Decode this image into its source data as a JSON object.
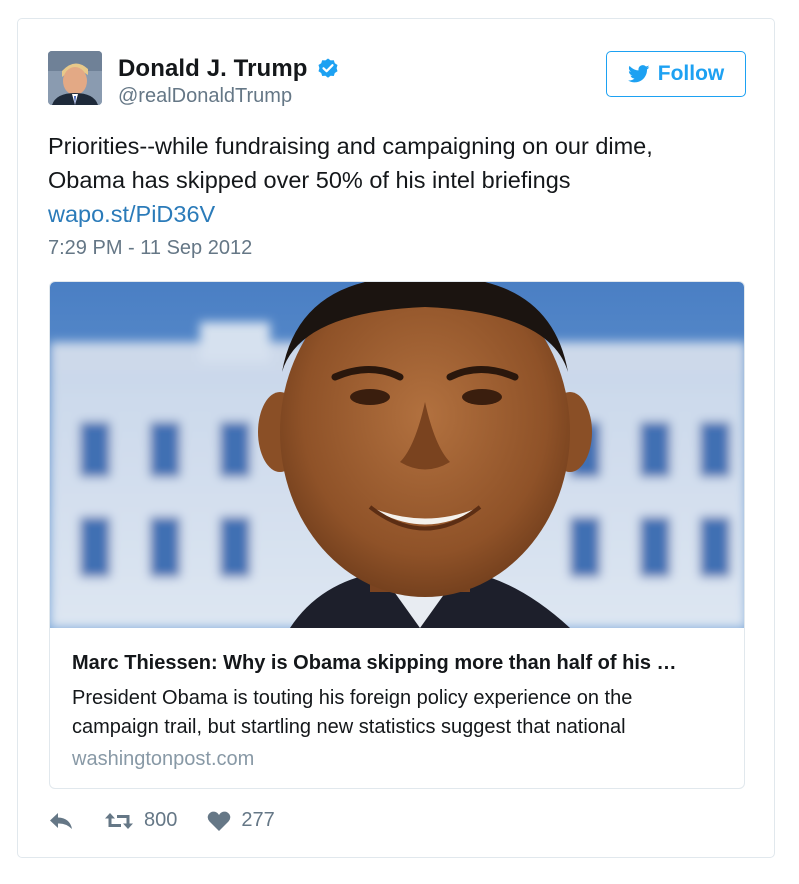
{
  "author": {
    "display_name": "Donald J. Trump",
    "handle": "@realDonaldTrump",
    "verified": true
  },
  "follow_button": {
    "label": "Follow"
  },
  "tweet": {
    "text_lines": [
      "Priorities--while fundraising and campaigning on our dime,",
      "Obama has skipped over 50% of his intel briefings"
    ],
    "link": "wapo.st/PiD36V",
    "timestamp": "7:29 PM - 11 Sep 2012"
  },
  "card": {
    "title": "Marc Thiessen: Why is Obama skipping more than half of his …",
    "description_lines": [
      "President Obama is touting his foreign policy experience on the",
      "campaign trail, but startling new statistics suggest that national"
    ],
    "domain": "washingtonpost.com"
  },
  "actions": {
    "retweet_count": "800",
    "like_count": "277"
  },
  "colors": {
    "brand_blue": "#1da1f2",
    "link_blue": "#2b7bb9",
    "secondary_text": "#657786",
    "border": "#e1e8ed"
  },
  "icons": {
    "verified": "verified-badge-icon",
    "follow": "twitter-bird-icon",
    "reply": "reply-icon",
    "retweet": "retweet-icon",
    "like": "heart-icon"
  }
}
